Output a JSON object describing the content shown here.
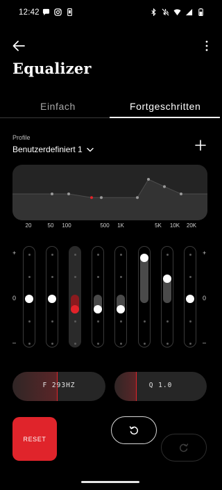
{
  "status": {
    "time": "12:42",
    "left_icons": [
      "chat-bubble-icon",
      "instagram-icon",
      "phone-icon"
    ],
    "right_icons": [
      "bluetooth-icon",
      "mute-icon",
      "wifi-icon",
      "signal-icon",
      "battery-icon"
    ]
  },
  "header": {
    "title": "Equalizer"
  },
  "tabs": [
    {
      "label": "Einfach",
      "selected": false
    },
    {
      "label": "Fortgeschritten",
      "selected": true
    }
  ],
  "profile": {
    "label": "Profile",
    "value": "Benutzerdefiniert 1"
  },
  "eq": {
    "freq_labels": [
      "20",
      "50",
      "100",
      "500",
      "1K",
      "5K",
      "10K",
      "20K"
    ],
    "scale_labels": {
      "top": "+",
      "mid": "0",
      "bottom": "–"
    },
    "bands": [
      {
        "level": 0
      },
      {
        "level": 0
      },
      {
        "level": -0.25,
        "selected": true
      },
      {
        "level": -0.25
      },
      {
        "level": -0.25
      },
      {
        "level": 1
      },
      {
        "level": 0.5
      },
      {
        "level": 0
      }
    ]
  },
  "params": {
    "freq_label": "F 293HZ",
    "freq_fill": 0.48,
    "q_label": "Q 1.0",
    "q_fill": 0.23
  },
  "actions": {
    "reset_label": "RESET"
  },
  "colors": {
    "accent": "#e2232a",
    "background": "#000000",
    "surface": "#242424"
  }
}
